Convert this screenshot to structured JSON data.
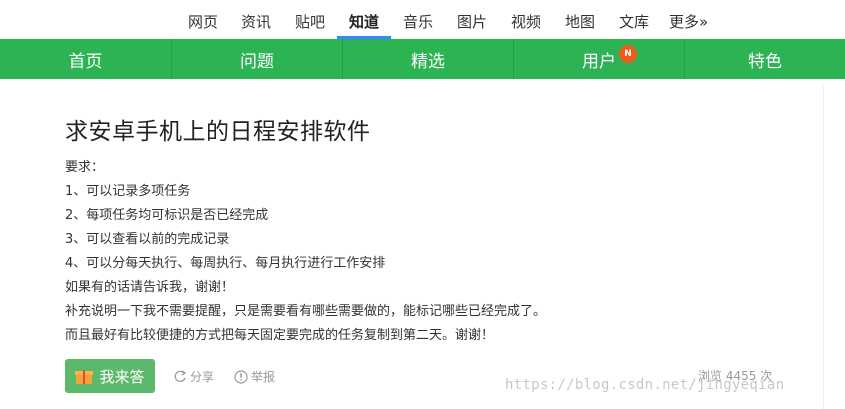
{
  "topnav": {
    "items": [
      "网页",
      "资讯",
      "贴吧",
      "知道",
      "音乐",
      "图片",
      "视频",
      "地图",
      "文库",
      "更多»"
    ],
    "active_index": 3
  },
  "greenbar": {
    "items": [
      "首页",
      "问题",
      "精选",
      "用户",
      "特色"
    ],
    "badge": "N",
    "accent_color": "#2cb353"
  },
  "question": {
    "title": "求安卓手机上的日程安排软件",
    "lines": [
      "要求：",
      "1、可以记录多项任务",
      "2、每项任务均可标识是否已经完成",
      "3、可以查看以前的完成记录",
      "4、可以分每天执行、每周执行、每月执行进行工作安排",
      "如果有的话请告诉我，谢谢！",
      "补充说明一下我不需要提醒，只是需要看有哪些需要做的，能标记哪些已经完成了。",
      "而且最好有比较便捷的方式把每天固定要完成的任务复制到第二天。谢谢！"
    ]
  },
  "actions": {
    "answer_label": "我来答",
    "share_label": "分享",
    "report_label": "举报",
    "views_label": "浏览 4455 次"
  },
  "watermark": "https://blog.csdn.net/jingyeqian"
}
